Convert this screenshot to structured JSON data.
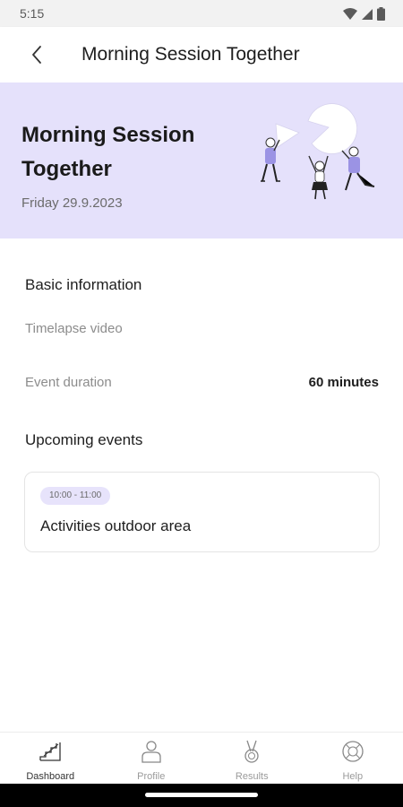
{
  "status": {
    "time": "5:15",
    "icons": [
      "wifi-icon",
      "cellular-icon",
      "battery-icon"
    ]
  },
  "app_bar": {
    "title": "Morning Session Together",
    "back_icon": "chevron-left-icon"
  },
  "hero": {
    "title": "Morning Session Together",
    "date": "Friday 29.9.2023",
    "background": "#e5e1fb",
    "illustration": "people-carrying-pie-chart"
  },
  "basic_info": {
    "heading": "Basic information",
    "timelapse_label": "Timelapse video",
    "duration_label": "Event duration",
    "duration_value": "60 minutes"
  },
  "upcoming": {
    "heading": "Upcoming events",
    "events": [
      {
        "time": "10:00 - 11:00",
        "title": "Activities outdoor area"
      }
    ]
  },
  "nav": {
    "items": [
      {
        "label": "Dashboard",
        "icon": "stairs-icon",
        "active": true
      },
      {
        "label": "Profile",
        "icon": "person-icon",
        "active": false
      },
      {
        "label": "Results",
        "icon": "medal-icon",
        "active": false
      },
      {
        "label": "Help",
        "icon": "help-circle-icon",
        "active": false
      }
    ]
  },
  "colors": {
    "accent": "#e5e1fb",
    "chip": "#e7e3fb",
    "figure": "#9b93e4"
  }
}
